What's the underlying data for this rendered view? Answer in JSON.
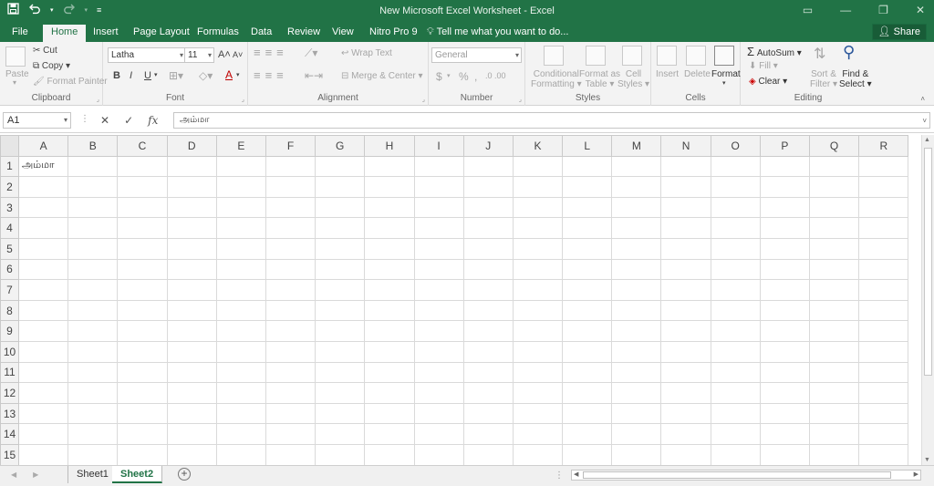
{
  "window": {
    "title": "New Microsoft Excel Worksheet - Excel",
    "save_icon": "save-icon",
    "undo_icon": "undo-icon",
    "redo_icon": "redo-icon"
  },
  "tabs": [
    {
      "label": "File",
      "active": false
    },
    {
      "label": "Home",
      "active": true
    },
    {
      "label": "Insert",
      "active": false
    },
    {
      "label": "Page Layout",
      "active": false
    },
    {
      "label": "Formulas",
      "active": false
    },
    {
      "label": "Data",
      "active": false
    },
    {
      "label": "Review",
      "active": false
    },
    {
      "label": "View",
      "active": false
    },
    {
      "label": "Nitro Pro 9",
      "active": false
    }
  ],
  "tellme": "Tell me what you want to do...",
  "share": "Share",
  "ribbon": {
    "clipboard": {
      "paste": "Paste",
      "cut": "Cut",
      "copy": "Copy",
      "format_painter": "Format Painter",
      "label": "Clipboard"
    },
    "font": {
      "name": "Latha",
      "size": "11",
      "label": "Font",
      "bold": "B",
      "italic": "I",
      "underline": "U"
    },
    "alignment": {
      "wrap_text": "Wrap Text",
      "merge_center": "Merge & Center",
      "label": "Alignment"
    },
    "number": {
      "format": "General",
      "currency": "$",
      "percent": "%",
      "label": "Number"
    },
    "styles": {
      "conditional_1": "Conditional",
      "conditional_2": "Formatting",
      "format_table_1": "Format as",
      "format_table_2": "Table",
      "cell_styles_1": "Cell",
      "cell_styles_2": "Styles",
      "label": "Styles"
    },
    "cells": {
      "insert": "Insert",
      "delete": "Delete",
      "format": "Format",
      "label": "Cells"
    },
    "editing": {
      "autosum": "AutoSum",
      "fill": "Fill",
      "clear": "Clear",
      "sort_1": "Sort &",
      "sort_2": "Filter",
      "find_1": "Find &",
      "find_2": "Select",
      "label": "Editing"
    }
  },
  "formula_bar": {
    "name_box": "A1",
    "fx": "fx",
    "value": "அம்மா"
  },
  "grid": {
    "columns": [
      "A",
      "B",
      "C",
      "D",
      "E",
      "F",
      "G",
      "H",
      "I",
      "J",
      "K",
      "L",
      "M",
      "N",
      "O",
      "P",
      "Q",
      "R"
    ],
    "rows": [
      "1",
      "2",
      "3",
      "4",
      "5",
      "6",
      "7",
      "8",
      "9",
      "10",
      "11",
      "12",
      "13",
      "14",
      "15"
    ],
    "cells": {
      "A1": "அம்மா"
    }
  },
  "sheets": [
    {
      "label": "Sheet1",
      "active": false
    },
    {
      "label": "Sheet2",
      "active": true
    }
  ],
  "colors": {
    "accent": "#217346"
  }
}
